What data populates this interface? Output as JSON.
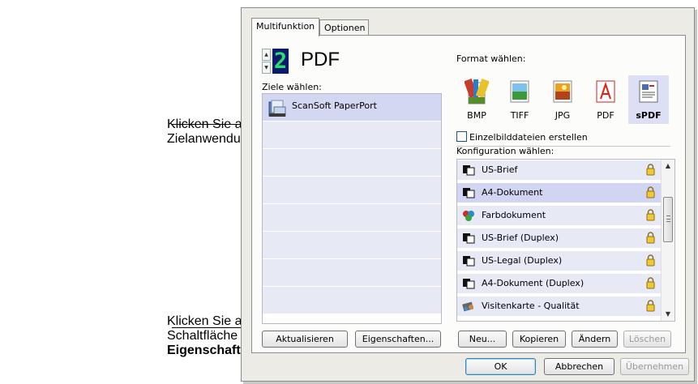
{
  "callouts": {
    "destination": "Klicken Sie auf eine Zielanwendung.",
    "properties_prefix": "Klicken Sie auf die Schaltfläche",
    "properties_bold": "Eigenschaften",
    "properties_suffix": "."
  },
  "tabs": [
    {
      "label": "Multifunktion",
      "active": true
    },
    {
      "label": "Optionen",
      "active": false
    }
  ],
  "left": {
    "digit": "2",
    "format_name": "PDF",
    "destinations_label": "Ziele wählen:",
    "destinations": [
      "ScanSoft PaperPort"
    ],
    "refresh_button": "Aktualisieren",
    "properties_button": "Eigenschaften..."
  },
  "right": {
    "format_label": "Format wählen:",
    "formats": [
      "BMP",
      "TIFF",
      "JPG",
      "PDF",
      "sPDF"
    ],
    "selected_format": "sPDF",
    "single_files_label": "Einzelbilddateien erstellen",
    "single_files_checked": false,
    "config_label": "Konfiguration wählen:",
    "configs": [
      {
        "label": "US-Brief",
        "icon": "bw-document-icon"
      },
      {
        "label": "A4-Dokument",
        "icon": "bw-document-icon"
      },
      {
        "label": "Farbdokument",
        "icon": "color-document-icon"
      },
      {
        "label": "US-Brief (Duplex)",
        "icon": "bw-document-icon"
      },
      {
        "label": "US-Legal (Duplex)",
        "icon": "bw-document-icon"
      },
      {
        "label": "A4-Dokument (Duplex)",
        "icon": "bw-document-icon"
      },
      {
        "label": "Visitenkarte - Qualität",
        "icon": "business-card-icon"
      }
    ],
    "selected_config": "A4-Dokument",
    "buttons": {
      "new": "Neu...",
      "copy": "Kopieren",
      "edit": "Ändern",
      "delete": "Löschen"
    }
  },
  "footer": {
    "ok": "OK",
    "cancel": "Abbrechen",
    "apply": "Übernehmen"
  },
  "colors": {
    "selection": "#d4d7f2",
    "list_row": "#e7e9f5",
    "digit_bg": "#0b1a6a",
    "digit_fg": "#28e070"
  }
}
